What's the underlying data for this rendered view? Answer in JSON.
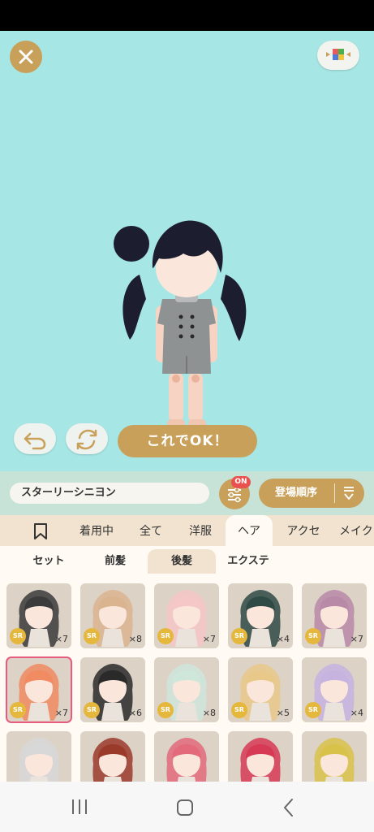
{
  "stage": {
    "bg_color": "#a6e6e4",
    "close_icon": "close-icon",
    "background_icon": "background-select-icon",
    "undo_icon": "undo-icon",
    "rotate_icon": "rotate-icon",
    "ok_label": "これでOK！"
  },
  "toolbar": {
    "name_value": "スターリーシニヨン",
    "filter_icon": "filter-sliders-icon",
    "filter_badge": "ON",
    "sort_label": "登場順序",
    "sort_icon": "sort-order-icon"
  },
  "tabs": [
    {
      "label": "",
      "icon": "bookmark-icon"
    },
    {
      "label": "着用中"
    },
    {
      "label": "全て"
    },
    {
      "label": "洋服"
    },
    {
      "label": "ヘア",
      "active": true
    },
    {
      "label": "アクセ"
    },
    {
      "label": "メイク"
    }
  ],
  "subtabs": [
    {
      "label": "セット"
    },
    {
      "label": "前髪"
    },
    {
      "label": "後髪",
      "active": true
    },
    {
      "label": "エクステ"
    }
  ],
  "items": [
    {
      "rarity": "SR",
      "count": "×7",
      "hair_color": "#3b3b3b"
    },
    {
      "rarity": "SR",
      "count": "×8",
      "hair_color": "#d9b48f"
    },
    {
      "rarity": "SR",
      "count": "×7",
      "hair_color": "#f6c7c7"
    },
    {
      "rarity": "SR",
      "count": "×4",
      "hair_color": "#2f4a44"
    },
    {
      "rarity": "SR",
      "count": "×7",
      "hair_color": "#b98aa8"
    },
    {
      "rarity": "SR",
      "count": "×7",
      "hair_color": "#f08b62",
      "selected": true
    },
    {
      "rarity": "SR",
      "count": "×6",
      "hair_color": "#2a2a2a"
    },
    {
      "rarity": "SR",
      "count": "×8",
      "hair_color": "#cfe6da"
    },
    {
      "rarity": "SR",
      "count": "×5",
      "hair_color": "#e9c98a"
    },
    {
      "rarity": "SR",
      "count": "×4",
      "hair_color": "#c6b3e0"
    },
    {
      "rarity": "",
      "count": "",
      "hair_color": "#d8d8d8"
    },
    {
      "rarity": "",
      "count": "",
      "hair_color": "#9a3a2a"
    },
    {
      "rarity": "",
      "count": "",
      "hair_color": "#e36a7a"
    },
    {
      "rarity": "",
      "count": "",
      "hair_color": "#d63a55"
    },
    {
      "rarity": "",
      "count": "",
      "hair_color": "#d9c24a"
    }
  ],
  "navbar": {
    "recents_icon": "recents-icon",
    "home_icon": "home-icon",
    "back_icon": "back-icon"
  }
}
